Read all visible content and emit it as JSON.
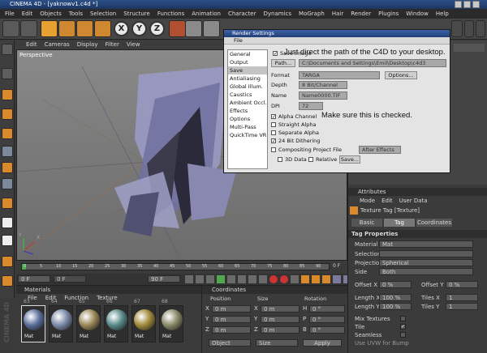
{
  "window": {
    "title": "CINEMA 4D - [yaknowv1.c4d *]"
  },
  "menubar": [
    "File",
    "Edit",
    "Objects",
    "Tools",
    "Selection",
    "Structure",
    "Functions",
    "Animation",
    "Character",
    "Dynamics",
    "MoGraph",
    "Hair",
    "Render",
    "Plugins",
    "Window",
    "Help"
  ],
  "toolbar": {
    "axis_x": "X",
    "axis_y": "Y",
    "axis_z": "Z"
  },
  "viewport": {
    "menu": [
      "Edit",
      "Cameras",
      "Display",
      "Filter",
      "View"
    ],
    "label": "Perspective"
  },
  "timeline": {
    "ticks": [
      "0",
      "5",
      "10",
      "15",
      "20",
      "25",
      "30",
      "35",
      "40",
      "45",
      "50",
      "55",
      "60",
      "65",
      "70",
      "75",
      "80",
      "85",
      "90"
    ],
    "end_frame": "0 F",
    "start_field": "0 F",
    "end_field": "90 F",
    "frame_left": "0 F",
    "frame_mid": "90 F"
  },
  "materials": {
    "title": "Materials",
    "menu": [
      "File",
      "Edit",
      "Function",
      "Texture"
    ],
    "thumbs": [
      {
        "num": "63",
        "label": "Mat",
        "color": "#5a6e9a"
      },
      {
        "num": "64",
        "label": "Mat",
        "color": "#7a8aa8"
      },
      {
        "num": "65",
        "label": "Mat",
        "color": "#9a8858"
      },
      {
        "num": "66",
        "label": "Mat",
        "color": "#5a8a8a"
      },
      {
        "num": "67",
        "label": "Mat",
        "color": "#a08a3a"
      },
      {
        "num": "68",
        "label": "Mat",
        "color": "#8a8a6a"
      }
    ]
  },
  "coordinates": {
    "title": "Coordinates",
    "position": "Position",
    "size": "Size",
    "rotation": "Rotation",
    "rows": [
      {
        "axis": "X",
        "pos": "0 m",
        "size": "0 m",
        "rlabel": "H",
        "rot": "0 °"
      },
      {
        "axis": "Y",
        "pos": "0 m",
        "size": "0 m",
        "rlabel": "P",
        "rot": "0 °"
      },
      {
        "axis": "Z",
        "pos": "0 m",
        "size": "0 m",
        "rlabel": "B",
        "rot": "0 °"
      }
    ],
    "object_select": "Object",
    "size_select": "Size",
    "apply": "Apply"
  },
  "attributes": {
    "title": "Attributes",
    "menu": [
      "Mode",
      "Edit",
      "User Data"
    ],
    "object_name": "Texture Tag [Texture]",
    "tabs": [
      "Basic",
      "Tag",
      "Coordinates"
    ],
    "section": "Tag Properties",
    "material_label": "Material",
    "material_value": "Mat",
    "selection_label": "Selection",
    "projection_label": "Projection",
    "projection_value": "Spherical",
    "side_label": "Side",
    "side_value": "Both",
    "offset_x_label": "Offset X",
    "offset_x_value": "0 %",
    "offset_y_label": "Offset Y",
    "offset_y_value": "0 %",
    "length_x_label": "Length X",
    "length_x_value": "100 %",
    "tiles_x_label": "Tiles X",
    "tiles_x_value": "1",
    "length_y_label": "Length Y",
    "length_y_value": "100 %",
    "tiles_y_label": "Tiles Y",
    "tiles_y_value": "1",
    "mix_label": "Mix Textures",
    "tile_label": "Tile",
    "seamless_label": "Seamless",
    "uvw_label": "Use UVW for Bump"
  },
  "render_dialog": {
    "title": "Render Settings",
    "menu": "File",
    "categories": [
      "General",
      "Output",
      "Save",
      "Antialiasing",
      "Global Illum.",
      "Caustics",
      "Ambient Occl.",
      "Effects",
      "Options",
      "Multi-Pass",
      "QuickTime VR"
    ],
    "selected_category": "Save",
    "save_image_label": "Save Image",
    "path_button": "Path...",
    "path_value": "C:\\Documents and Settings\\Emil\\Desktop\\c4d3",
    "format_label": "Format",
    "format_value": "TARGA",
    "options_button": "Options...",
    "depth_label": "Depth",
    "depth_value": "8 Bit/Channel",
    "name_label": "Name",
    "name_value": "Name0000.TIF",
    "dpi_label": "DPI",
    "dpi_value": "72",
    "alpha_label": "Alpha Channel",
    "straight_label": "Straight Alpha",
    "separate_label": "Separate Alpha",
    "dither_label": "24 Bit Dithering",
    "compositing_label": "Compositing Project File",
    "after_effects": "After Effects",
    "data3d_label": "3D Data",
    "relative_label": "Relative",
    "save_button": "Save..."
  },
  "annotations": {
    "path_note": "Just direct the path of the C4D to your desktop.",
    "alpha_note": "Make sure this is checked."
  },
  "watermark": "CINEMA 4D"
}
